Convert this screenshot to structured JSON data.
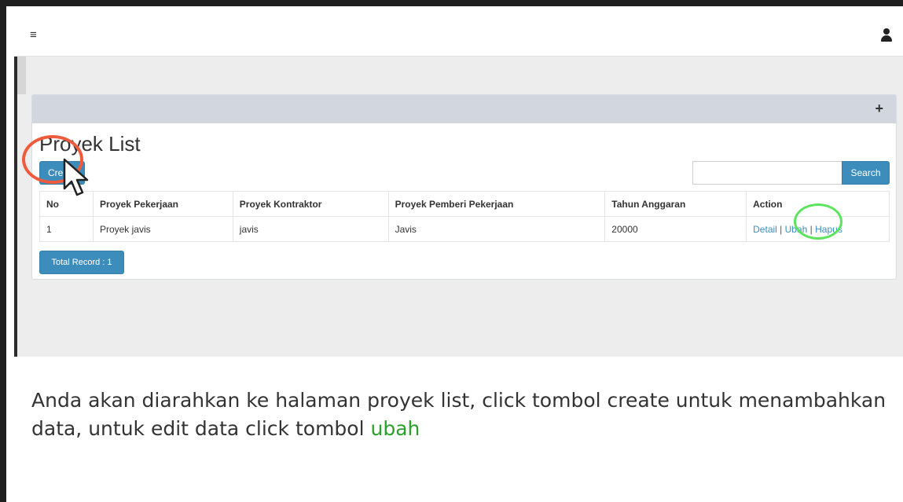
{
  "topbar": {
    "menu_icon": "hamburger-icon",
    "user_icon": "user-icon"
  },
  "panel": {
    "collapse_icon": "plus-icon",
    "title": "Proyek List",
    "create_label": "Create",
    "search": {
      "value": "",
      "placeholder": "",
      "button_label": "Search"
    },
    "table": {
      "columns": [
        "No",
        "Proyek Pekerjaan",
        "Proyek Kontraktor",
        "Proyek Pemberi Pekerjaan",
        "Tahun Anggaran",
        "Action"
      ],
      "rows": [
        {
          "no": "1",
          "pekerjaan": "Proyek javis",
          "kontraktor": "javis",
          "pemberi": "Javis",
          "tahun": "20000",
          "actions": {
            "detail": "Detail",
            "separator1": "|",
            "ubah": "Ubah",
            "separator2": "|",
            "hapus": "Hapus"
          }
        }
      ]
    },
    "total_label": "Total Record : 1"
  },
  "annotations": {
    "create_ring_color": "#ef5b3d",
    "ubah_ring_color": "#5ee35e"
  },
  "caption": {
    "text": "Anda akan diarahkan ke halaman proyek list, click tombol create untuk menambahkan data, untuk edit data click tombol",
    "highlight": "ubah",
    "highlight_color": "#2aa12a"
  },
  "colors": {
    "primary": "#3c8dbc",
    "panel_header": "#d2d6de",
    "page_bg": "#ededed"
  }
}
